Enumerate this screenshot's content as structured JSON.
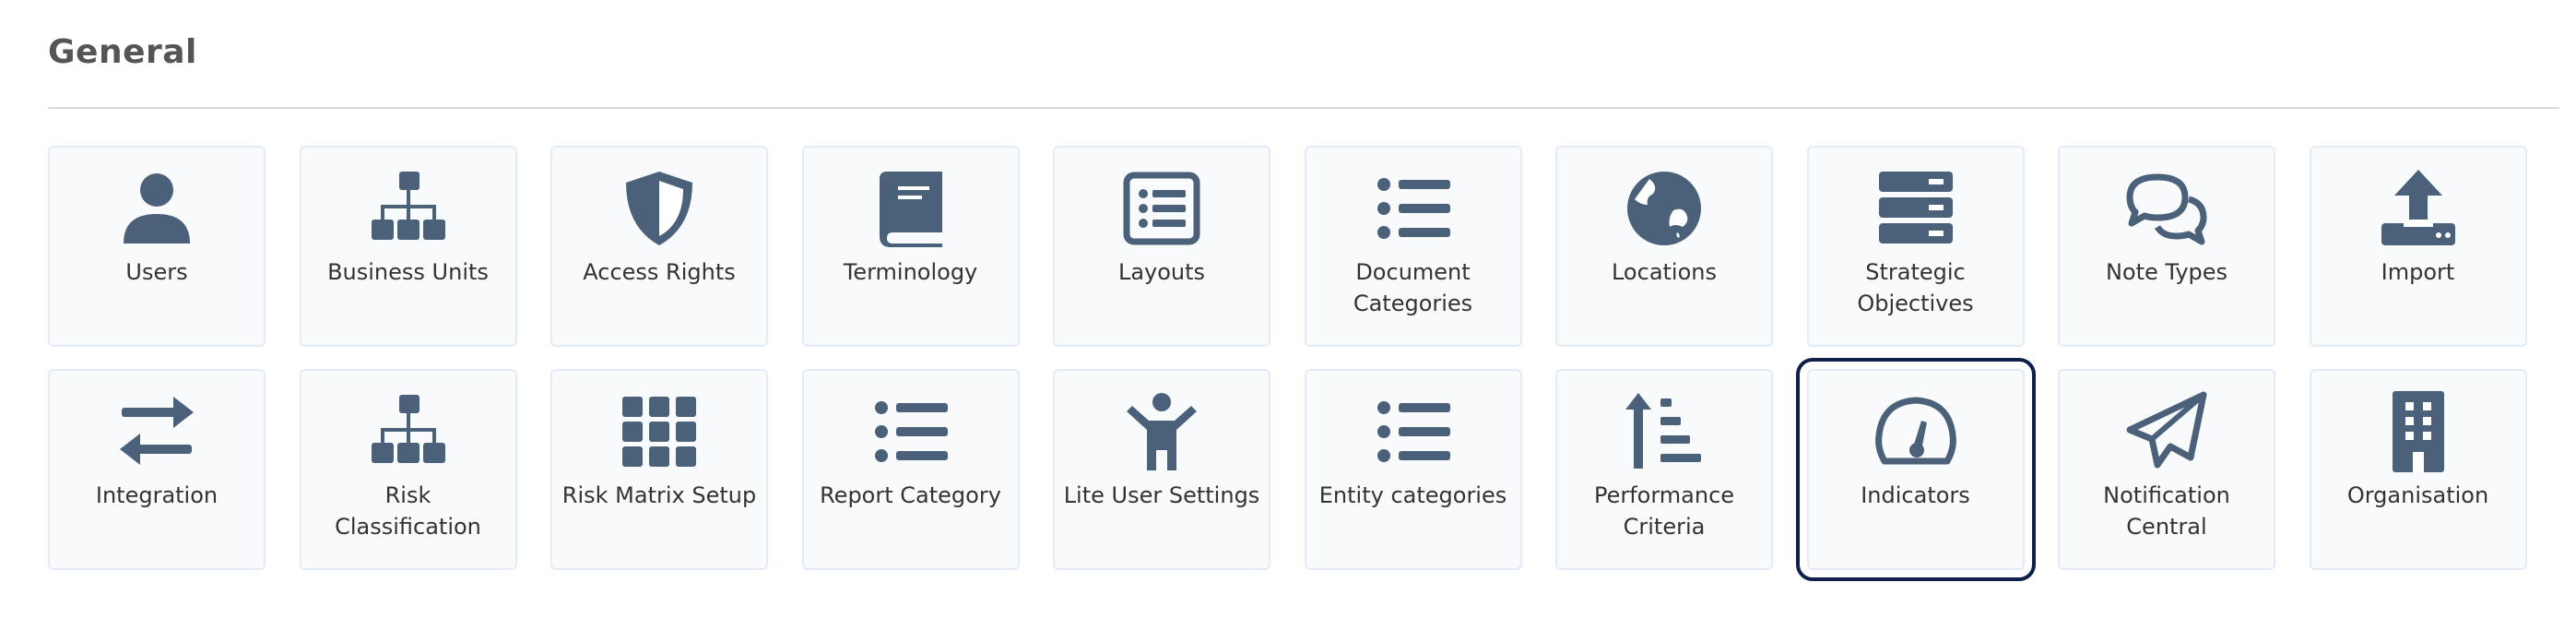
{
  "section": {
    "title": "General"
  },
  "colors": {
    "icon": "#4b6079",
    "tile_bg": "#f8fafc",
    "tile_border": "#e3ecf6",
    "selected_outline": "#0f1f4b"
  },
  "tiles": [
    {
      "label": "Users",
      "icon": "user-icon"
    },
    {
      "label": "Business Units",
      "icon": "sitemap-icon"
    },
    {
      "label": "Access Rights",
      "icon": "shield-icon"
    },
    {
      "label": "Terminology",
      "icon": "book-icon"
    },
    {
      "label": "Layouts",
      "icon": "list-alt-icon"
    },
    {
      "label": "Document Categories",
      "icon": "list-icon"
    },
    {
      "label": "Locations",
      "icon": "globe-icon"
    },
    {
      "label": "Strategic Objectives",
      "icon": "server-icon"
    },
    {
      "label": "Note Types",
      "icon": "comments-icon"
    },
    {
      "label": "Import",
      "icon": "upload-icon"
    },
    {
      "label": "Integration",
      "icon": "exchange-icon"
    },
    {
      "label": "Risk Classification",
      "icon": "sitemap-icon"
    },
    {
      "label": "Risk Matrix Setup",
      "icon": "grid-icon"
    },
    {
      "label": "Report Category",
      "icon": "list-icon"
    },
    {
      "label": "Lite User Settings",
      "icon": "child-icon"
    },
    {
      "label": "Entity categories",
      "icon": "list-icon"
    },
    {
      "label": "Performance Criteria",
      "icon": "sort-amount-up-icon"
    },
    {
      "label": "Indicators",
      "icon": "tachometer-icon",
      "selected": true
    },
    {
      "label": "Notification Central",
      "icon": "paper-plane-icon"
    },
    {
      "label": "Organisation",
      "icon": "building-icon"
    }
  ]
}
